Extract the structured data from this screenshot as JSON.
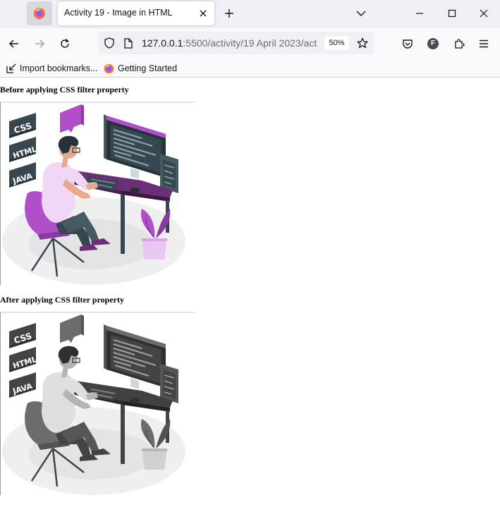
{
  "browser": {
    "tab": {
      "title": "Activity 19 - Image in HTML"
    },
    "address": {
      "host": "127.0.0.1",
      "rest": ":5500/activity/19 April 2023/act",
      "zoom": "50%"
    },
    "bookmarks": [
      {
        "label": "Import bookmarks..."
      },
      {
        "label": "Getting Started"
      }
    ],
    "account_initial": "F"
  },
  "page": {
    "before_caption": "Before applying CSS filter property",
    "after_caption": "After applying CSS filter property",
    "illustration": {
      "badges": [
        "CSS",
        "HTML",
        "JAVA"
      ],
      "code_sign": "</>",
      "before_filter": "none",
      "after_filter": "grayscale(100%)"
    }
  },
  "colors": {
    "accent_purple": "#b04fc9",
    "desk_purple": "#6b2f78",
    "badge_dark": "#37474f"
  }
}
